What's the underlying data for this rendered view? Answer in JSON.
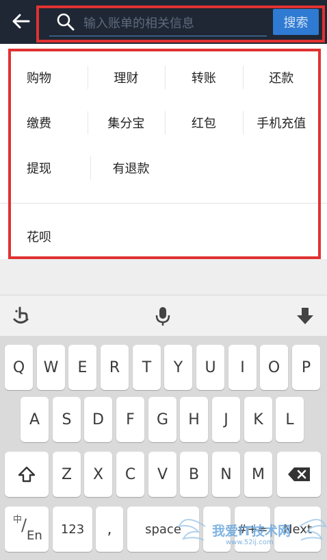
{
  "header": {
    "search_placeholder": "输入账单的相关信息",
    "search_button": "搜索"
  },
  "categories": {
    "rows": [
      [
        "购物",
        "理财",
        "转账",
        "还款"
      ],
      [
        "缴费",
        "集分宝",
        "红包",
        "手机充值"
      ],
      [
        "提现",
        "有退款"
      ]
    ],
    "extra": "花呗"
  },
  "keyboard": {
    "row1": [
      "Q",
      "W",
      "E",
      "R",
      "T",
      "Y",
      "U",
      "I",
      "O",
      "P"
    ],
    "row2": [
      "A",
      "S",
      "D",
      "F",
      "G",
      "H",
      "J",
      "K",
      "L"
    ],
    "row3": [
      "Z",
      "X",
      "C",
      "V",
      "B",
      "N",
      "M"
    ],
    "lang_top": "中",
    "lang_bottom": "En",
    "numbers": "123",
    "comma": ",",
    "space": "space",
    "symbols": "#+=",
    "next": "Next"
  },
  "watermark": {
    "text": "我爱IT技术网",
    "url": "www.52ij.com"
  },
  "colors": {
    "header_bg": "#1f2734",
    "accent": "#2f7ad2",
    "annotation": "#e03232"
  }
}
